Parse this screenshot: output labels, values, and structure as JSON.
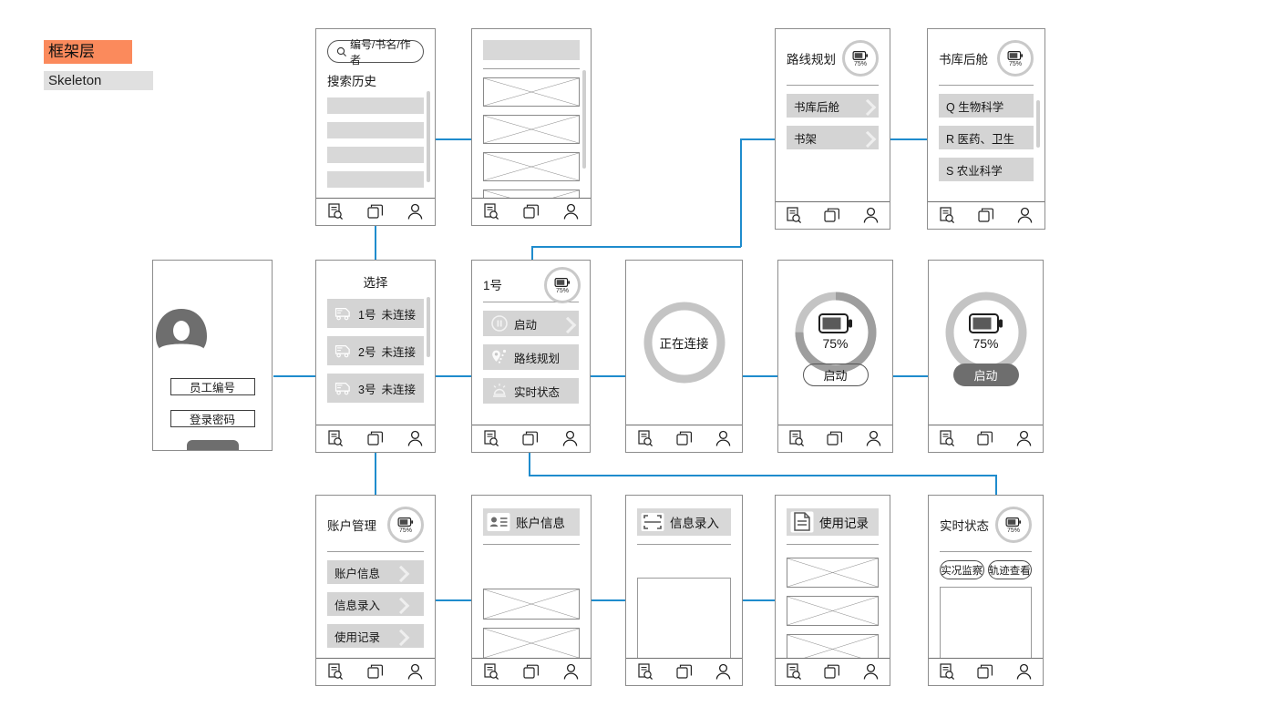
{
  "legend": {
    "cn": "框架层",
    "en": "Skeleton",
    "accent_color": "#fb8a5c",
    "muted_color": "#e0e0e0"
  },
  "connector_color": "#1f8ccd",
  "nav": {
    "items": [
      {
        "name": "search-records-icon",
        "label": "search-records"
      },
      {
        "name": "layers-icon",
        "label": "layers"
      },
      {
        "name": "account-icon",
        "label": "account"
      }
    ]
  },
  "battery": {
    "percent_label": "75%",
    "percent": 75
  },
  "screens": {
    "search": {
      "search_placeholder": "编号/书名/作者",
      "history_title": "搜索历史",
      "history_items": [
        "",
        "",
        "",
        ""
      ]
    },
    "search_results": {
      "result_items": [
        "",
        "",
        "",
        ""
      ]
    },
    "route_planning": {
      "title": "路线规划",
      "battery_label": "75%",
      "items": [
        "书库后舱",
        "书架"
      ]
    },
    "library_rear": {
      "title": "书库后舱",
      "battery_label": "75%",
      "items": [
        "Q 生物科学",
        "R 医药、卫生",
        "S 农业科学"
      ]
    },
    "login": {
      "employee_id": "员工编号",
      "password": "登录密码",
      "submit_label": ""
    },
    "select_vehicle": {
      "title": "选择",
      "items": [
        {
          "label": "1号",
          "status": "未连接"
        },
        {
          "label": "2号",
          "status": "未连接"
        },
        {
          "label": "3号",
          "status": "未连接"
        }
      ]
    },
    "vehicle_menu": {
      "title": "1号",
      "battery_label": "75%",
      "items": [
        {
          "label": "启动",
          "icon": "pause-icon",
          "chevron": true
        },
        {
          "label": "路线规划",
          "icon": "location-pin-icon",
          "chevron": false
        },
        {
          "label": "实时状态",
          "icon": "siren-icon",
          "chevron": false
        }
      ]
    },
    "connecting": {
      "status_label": "正在连接"
    },
    "battery_idle": {
      "percent_label": "75%",
      "start_label": "启动"
    },
    "battery_active": {
      "percent_label": "75%",
      "start_label": "启动"
    },
    "account_management": {
      "title": "账户管理",
      "battery_label": "75%",
      "items": [
        "账户信息",
        "信息录入",
        "使用记录"
      ]
    },
    "account_info": {
      "title": "账户信息",
      "icon": "contact-card-icon",
      "placeholders": [
        "",
        ""
      ]
    },
    "info_entry": {
      "title": "信息录入",
      "icon": "scan-frame-icon"
    },
    "usage_records": {
      "title": "使用记录",
      "icon": "document-icon",
      "placeholders": [
        "",
        "",
        ""
      ]
    },
    "realtime_status": {
      "title": "实时状态",
      "battery_label": "75%",
      "tabs": [
        "实况监察",
        "轨迹查看"
      ]
    }
  }
}
